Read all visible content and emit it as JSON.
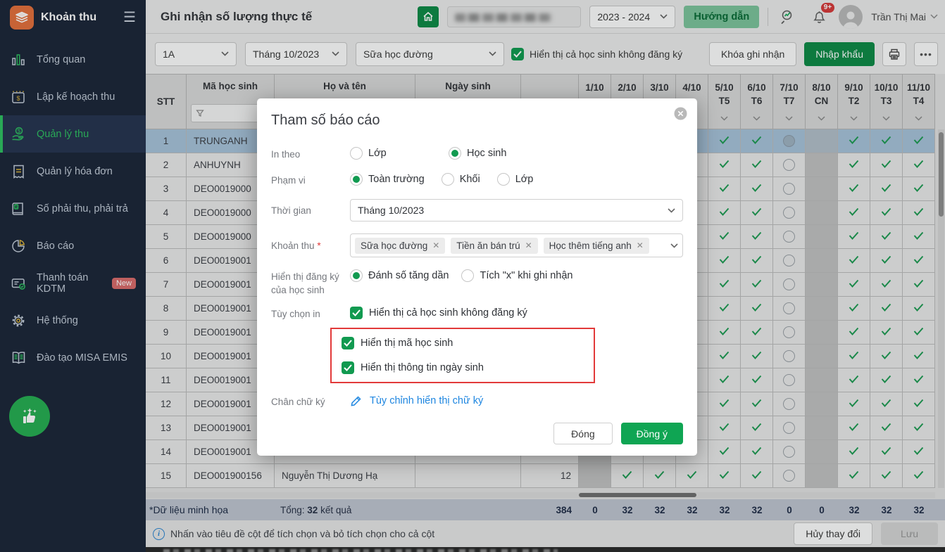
{
  "accent": {
    "green": "#0e8a47",
    "sidebar_green": "#2fbf61",
    "red_annotation": "#e23a3a",
    "link_blue": "#1e86e0"
  },
  "app": {
    "title": "Khoản thu"
  },
  "sidebar": {
    "items": [
      {
        "label": "Tổng quan",
        "icon": "bar-chart-icon",
        "active": false,
        "badge": ""
      },
      {
        "label": "Lập kế hoạch thu",
        "icon": "calendar-icon",
        "active": false,
        "badge": ""
      },
      {
        "label": "Quản lý thu",
        "icon": "hand-coin-icon",
        "active": true,
        "badge": ""
      },
      {
        "label": "Quản lý hóa đơn",
        "icon": "invoice-icon",
        "active": false,
        "badge": ""
      },
      {
        "label": "Số phải thu, phải trả",
        "icon": "ledger-icon",
        "active": false,
        "badge": ""
      },
      {
        "label": "Báo cáo",
        "icon": "pie-chart-icon",
        "active": false,
        "badge": ""
      },
      {
        "label": "Thanh toán KDTM",
        "icon": "card-icon",
        "active": false,
        "badge": "New"
      },
      {
        "label": "Hệ thống",
        "icon": "gear-icon",
        "active": false,
        "badge": ""
      },
      {
        "label": "Đào tạo MISA EMIS",
        "icon": "book-icon",
        "active": false,
        "badge": ""
      }
    ]
  },
  "topbar": {
    "page_title": "Ghi nhận số lượng thực tế",
    "school_year": "2023 - 2024",
    "help_label": "Hướng dẫn",
    "notification_badge": "9+",
    "user_name": "Trần Thị Mai"
  },
  "toolbar": {
    "class_filter": "1A",
    "month_filter": "Tháng 10/2023",
    "fee_filter": "Sữa học đường",
    "show_unregistered_label": "Hiển thị cả học sinh không đăng ký",
    "lock_button": "Khóa ghi nhận",
    "import_button": "Nhập khẩu",
    "more_button": "•••"
  },
  "table": {
    "columns": {
      "stt": "STT",
      "code": "Mã học sinh",
      "name": "Họ và tên",
      "birth": "Ngày sinh",
      "count": ""
    },
    "date_columns": [
      {
        "date": "1/10",
        "day": ""
      },
      {
        "date": "2/10",
        "day": ""
      },
      {
        "date": "3/10",
        "day": ""
      },
      {
        "date": "4/10",
        "day": ""
      },
      {
        "date": "5/10",
        "day": "T5"
      },
      {
        "date": "6/10",
        "day": "T6"
      },
      {
        "date": "7/10",
        "day": "T7"
      },
      {
        "date": "8/10",
        "day": "CN"
      },
      {
        "date": "9/10",
        "day": "T2"
      },
      {
        "date": "10/10",
        "day": "T3"
      },
      {
        "date": "11/10",
        "day": "T4"
      }
    ],
    "cell_pattern": [
      "off",
      "check",
      "check",
      "check",
      "check",
      "check",
      "circle",
      "off",
      "check",
      "check",
      "check"
    ],
    "rows": [
      {
        "stt": "1",
        "code": "TRUNGANH",
        "name": "",
        "birth": "",
        "count": "",
        "selected": true
      },
      {
        "stt": "2",
        "code": "ANHUYNH",
        "name": "",
        "birth": "",
        "count": "",
        "selected": false
      },
      {
        "stt": "3",
        "code": "DEO0019000",
        "name": "",
        "birth": "",
        "count": "",
        "selected": false
      },
      {
        "stt": "4",
        "code": "DEO0019000",
        "name": "",
        "birth": "",
        "count": "",
        "selected": false
      },
      {
        "stt": "5",
        "code": "DEO0019000",
        "name": "",
        "birth": "",
        "count": "",
        "selected": false
      },
      {
        "stt": "6",
        "code": "DEO0019001",
        "name": "",
        "birth": "",
        "count": "",
        "selected": false
      },
      {
        "stt": "7",
        "code": "DEO0019001",
        "name": "",
        "birth": "",
        "count": "",
        "selected": false
      },
      {
        "stt": "8",
        "code": "DEO0019001",
        "name": "",
        "birth": "",
        "count": "",
        "selected": false
      },
      {
        "stt": "9",
        "code": "DEO0019001",
        "name": "",
        "birth": "",
        "count": "",
        "selected": false
      },
      {
        "stt": "10",
        "code": "DEO0019001",
        "name": "",
        "birth": "",
        "count": "",
        "selected": false
      },
      {
        "stt": "11",
        "code": "DEO0019001",
        "name": "",
        "birth": "",
        "count": "",
        "selected": false
      },
      {
        "stt": "12",
        "code": "DEO0019001",
        "name": "",
        "birth": "",
        "count": "",
        "selected": false
      },
      {
        "stt": "13",
        "code": "DEO0019001",
        "name": "",
        "birth": "",
        "count": "",
        "selected": false
      },
      {
        "stt": "14",
        "code": "DEO0019001",
        "name": "",
        "birth": "",
        "count": "",
        "selected": false
      },
      {
        "stt": "15",
        "code": "DEO001900156",
        "name": "Nguyễn Thị Dương Hạ",
        "birth": "",
        "count": "12",
        "selected": false
      }
    ],
    "totals": {
      "demo_note": "*Dữ liệu minh họa",
      "label_prefix": "Tổng:",
      "result_count": "32",
      "label_suffix": "kết quả",
      "count_total": "384",
      "date_values": [
        "0",
        "32",
        "32",
        "32",
        "32",
        "32",
        "0",
        "0",
        "32",
        "32",
        "32"
      ]
    }
  },
  "footer": {
    "hint": "Nhấn vào tiêu đề cột để tích chọn và bỏ tích chọn cho cả cột",
    "cancel_button": "Hủy thay đổi",
    "save_button": "Lưu"
  },
  "modal": {
    "title": "Tham số báo cáo",
    "in_theo": {
      "label": "In theo",
      "options": [
        {
          "label": "Lớp",
          "checked": false
        },
        {
          "label": "Học sinh",
          "checked": true
        }
      ]
    },
    "pham_vi": {
      "label": "Phạm vi",
      "options": [
        {
          "label": "Toàn trường",
          "checked": true
        },
        {
          "label": "Khối",
          "checked": false
        },
        {
          "label": "Lớp",
          "checked": false
        }
      ]
    },
    "thoi_gian": {
      "label": "Thời gian",
      "value": "Tháng 10/2023"
    },
    "khoan_thu": {
      "label": "Khoản thu",
      "required_mark": "*",
      "tags": [
        "Sữa học đường",
        "Tiền ăn bán trú",
        "Học thêm tiếng anh"
      ]
    },
    "hien_thi_dang_ky": {
      "label": "Hiển thị đăng ký của học sinh",
      "options": [
        {
          "label": "Đánh số tăng dần",
          "checked": true
        },
        {
          "label": "Tích \"x\" khi ghi nhận",
          "checked": false
        }
      ]
    },
    "tuy_chon_in": {
      "label": "Tùy chọn in",
      "checkbox_plain": {
        "label": "Hiển thị cả học sinh không đăng ký",
        "checked": true
      },
      "checkboxes_highlighted": [
        {
          "label": "Hiển thị mã học sinh",
          "checked": true
        },
        {
          "label": "Hiển thị thông tin ngày sinh",
          "checked": true
        }
      ]
    },
    "chan_chu_ky": {
      "label": "Chân chữ ký",
      "link_label": "Tùy chỉnh hiển thị chữ ký"
    },
    "close_button": "Đóng",
    "ok_button": "Đồng ý"
  }
}
